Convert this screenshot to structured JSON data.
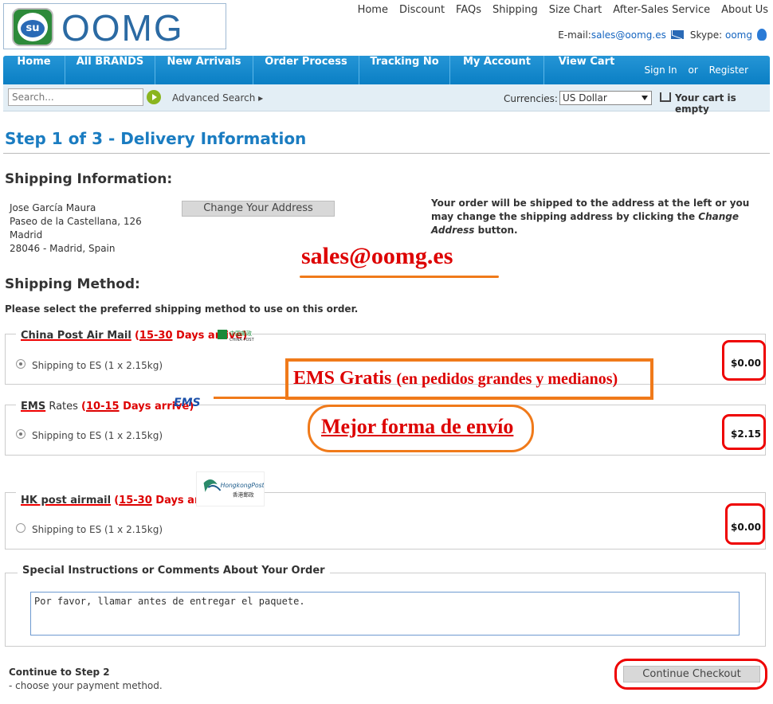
{
  "brand": {
    "logo_text": "OOMG",
    "badge_text": "su"
  },
  "top_links": [
    "Home",
    "Discount",
    "FAQs",
    "Shipping",
    "Size Chart",
    "After-Sales Service",
    "About Us"
  ],
  "contact": {
    "email_label": "E-mail:",
    "email": "sales@oomg.es",
    "skype_label": "Skype:",
    "skype": "oomg"
  },
  "nav": {
    "items": [
      "Home",
      "All BRANDS",
      "New Arrivals",
      "Order Process",
      "Tracking No",
      "My Account",
      "View Cart"
    ],
    "sign_in": "Sign In",
    "or": "or",
    "register": "Register"
  },
  "search": {
    "placeholder": "Search...",
    "advanced": "Advanced Search ▸",
    "currencies_label": "Currencies:",
    "currency_value": "US Dollar",
    "cart_text": "Your cart is empty"
  },
  "page": {
    "step_title": "Step 1 of 3 - Delivery Information"
  },
  "shipping_info": {
    "heading": "Shipping Information:",
    "address": [
      "Jose García Maura",
      "Paseo de la Castellana, 126",
      "Madrid",
      "28046 - Madrid, Spain"
    ],
    "change_button": "Change Your Address",
    "note_1": "Your order will be shipped to the address at the left or you may change the shipping address by clicking the ",
    "note_em": "Change Address",
    "note_2": " button."
  },
  "shipping_method": {
    "heading": "Shipping Method:",
    "instruction": "Please select the preferred shipping method to use on this order.",
    "options": [
      {
        "name": "China Post Air Mail",
        "open": "(",
        "days": "15-30",
        "days_text": " Days arrive)",
        "line": "Shipping to ES (1 x 2.15kg)",
        "price": "$0.00",
        "checked": true,
        "logo_text": "中国邮政 CHINA POST"
      },
      {
        "name": "EMS",
        "name_suffix": " Rates",
        "open": "(",
        "days": "10-15",
        "days_text": " Days arrive)",
        "line": "Shipping to ES (1 x 2.15kg)",
        "price": "$2.15",
        "checked": true,
        "logo_text": "EMS"
      },
      {
        "name": "HK post airmail",
        "open": "(",
        "days": "15-30",
        "days_text": " Days arrive)",
        "line": "Shipping to ES (1 x 2.15kg)",
        "price": "$0.00",
        "checked": false,
        "logo_text": "HongkongPost 香港郵政"
      }
    ]
  },
  "annotations": {
    "email": "sales@oomg.es",
    "ems_title": "EMS Gratis",
    "ems_sub": "(en pedidos grandes y medianos)",
    "best": "Mejor forma de envío"
  },
  "comments": {
    "legend": "Special Instructions or Comments About Your Order",
    "value": "Por favor, llamar antes de entregar el paquete."
  },
  "continue": {
    "title": "Continue to Step 2",
    "sub": "- choose your payment method.",
    "button": "Continue Checkout"
  },
  "colors": {
    "accent": "#1a7cc1",
    "nav": "#0a7fc4",
    "annotation_red": "#dd0000",
    "annotation_orange": "#f07a1a"
  }
}
